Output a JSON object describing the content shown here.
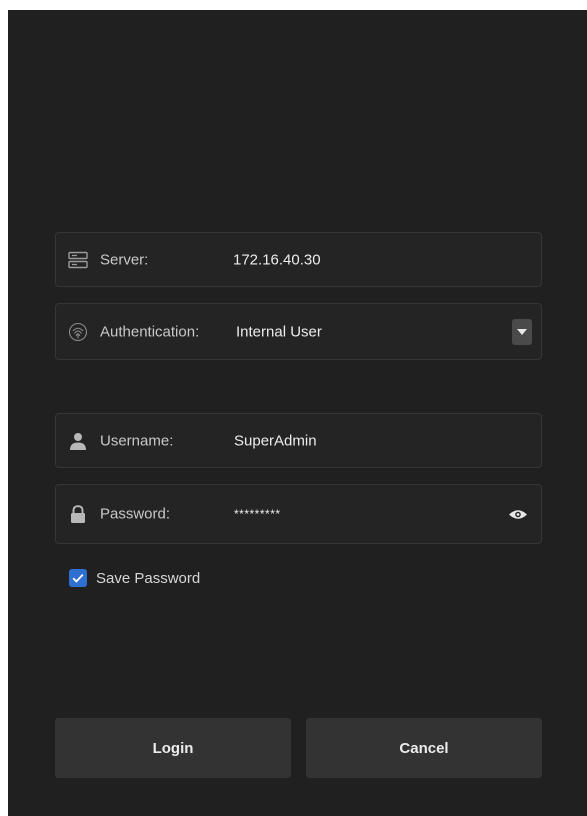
{
  "server": {
    "label": "Server:",
    "value": "172.16.40.30",
    "icon": "server-icon"
  },
  "authentication": {
    "label": "Authentication:",
    "value": "Internal User",
    "icon": "fingerprint-icon"
  },
  "username": {
    "label": "Username:",
    "value": "SuperAdmin",
    "icon": "user-icon"
  },
  "password": {
    "label": "Password:",
    "value": "*********",
    "icon": "lock-icon"
  },
  "save_password": {
    "label": "Save Password",
    "checked": true
  },
  "buttons": {
    "login": "Login",
    "cancel": "Cancel"
  },
  "colors": {
    "background": "#202020",
    "field_background": "#242424",
    "field_border": "#363636",
    "button_background": "#333333",
    "checkbox_accent": "#2f6fd0"
  }
}
